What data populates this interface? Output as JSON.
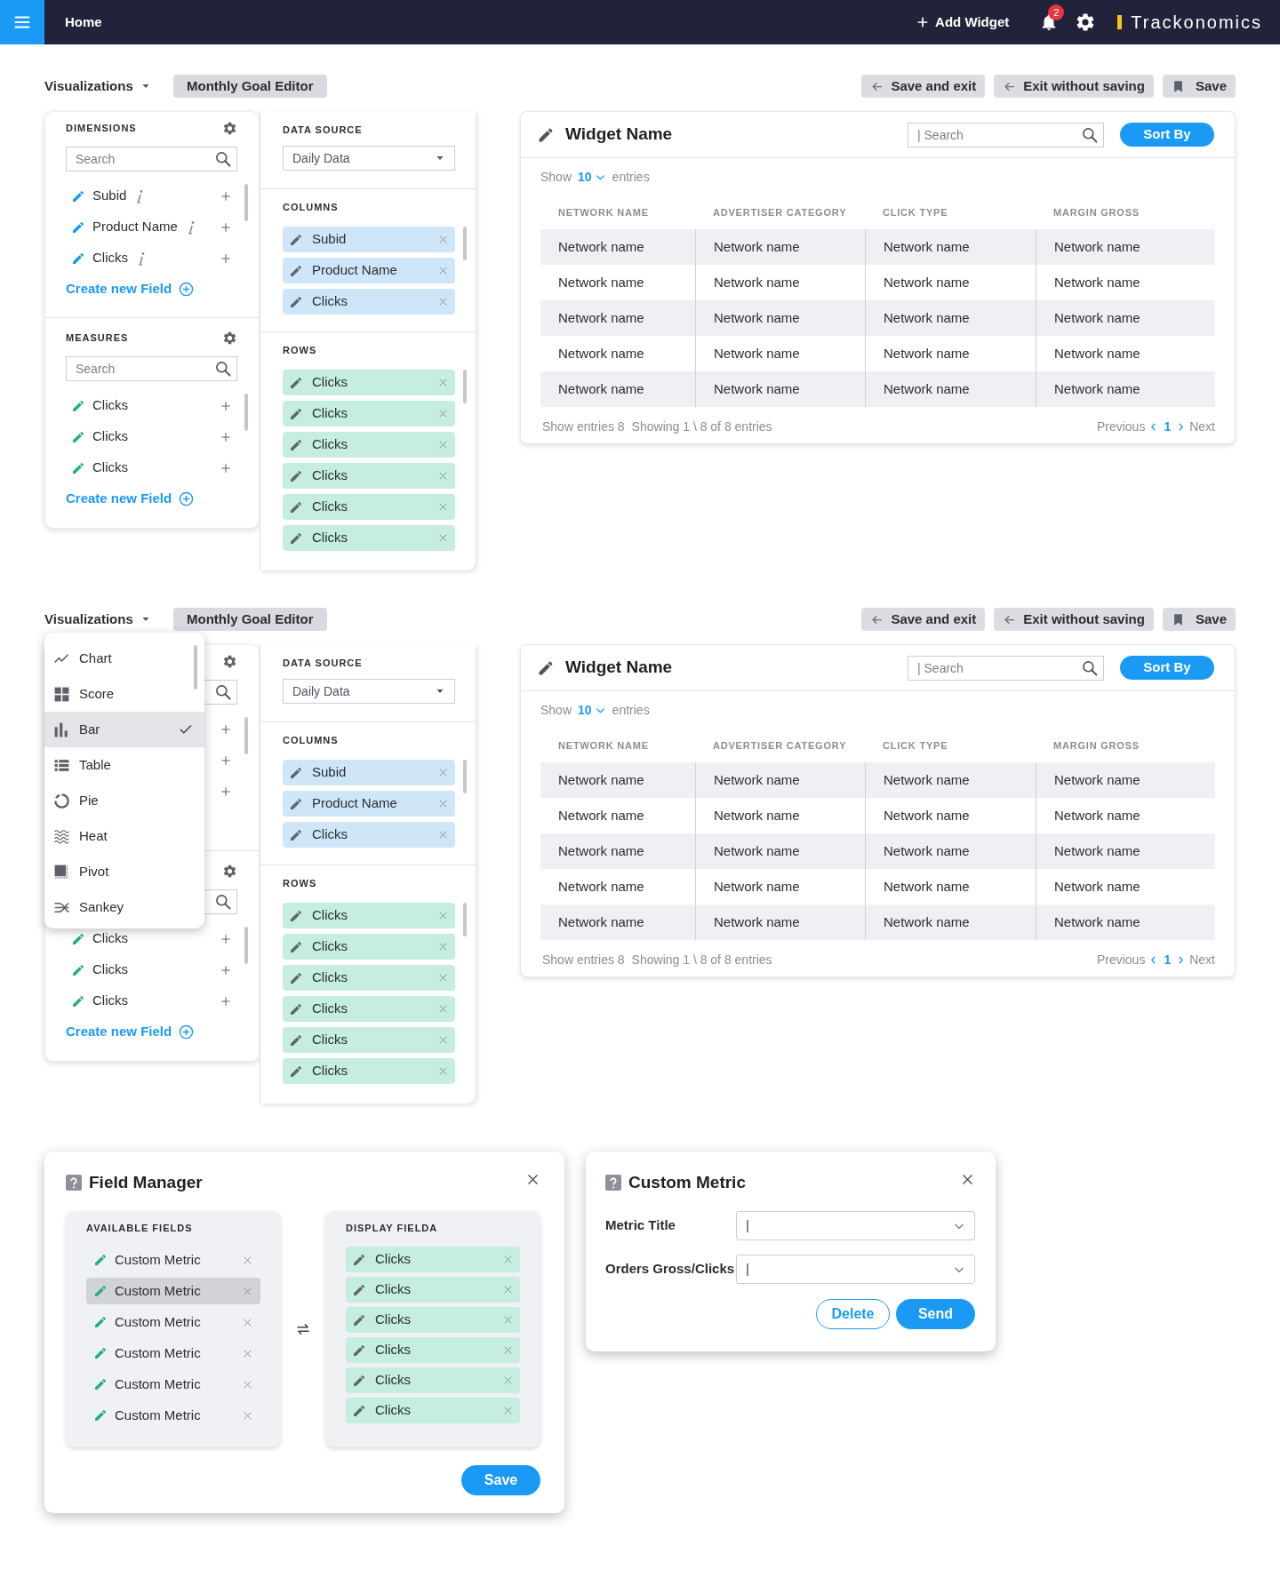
{
  "header": {
    "home": "Home",
    "add_widget": "Add Widget",
    "notification_count": "2",
    "brand": "Trackonomics"
  },
  "editors": [
    {
      "toolbar": {
        "menu": "Visualizations",
        "editor_name": "Monthly Goal Editor",
        "buttons": [
          {
            "label": "Save and exit",
            "kind": "back"
          },
          {
            "label": "Exit without saving",
            "kind": "back"
          },
          {
            "label": "Save",
            "kind": "bookmark"
          }
        ]
      },
      "dimensions": {
        "covered": false,
        "title": "DIMENSIONS",
        "search_placeholder": "Search",
        "items": [
          {
            "label": "Subid",
            "info": true
          },
          {
            "label": "Product Name",
            "info": true
          },
          {
            "label": "Clicks",
            "info": true
          }
        ],
        "create_link": "Create new Field"
      },
      "measures": {
        "title": "MEASURES",
        "search_placeholder": "Search",
        "items": [
          {
            "label": "Clicks",
            "info": false
          },
          {
            "label": "Clicks",
            "info": false
          },
          {
            "label": "Clicks",
            "info": false
          }
        ],
        "create_link": "Create new Field"
      },
      "data_source": {
        "title": "DATA SOURCE",
        "value": "Daily Data"
      },
      "columns": {
        "title": "COLUMNS",
        "chips": [
          "Subid",
          "Product Name",
          "Clicks"
        ]
      },
      "rows": {
        "title": "ROWS",
        "chips": [
          "Clicks",
          "Clicks",
          "Clicks",
          "Clicks",
          "Clicks",
          "Clicks"
        ]
      },
      "widget": {
        "title": "Widget Name",
        "search_placeholder": "| Search",
        "sort_button": "Sort By",
        "show_label": "Show",
        "page_size": "10",
        "entries_label": "entries",
        "columns": [
          "NETWORK NAME",
          "ADVERTISER CATEGORY",
          "CLICK TYPE",
          "MARGIN GROSS"
        ],
        "rows": [
          [
            "Network name",
            "Network name",
            "Network name",
            "Network name"
          ],
          [
            "Network name",
            "Network name",
            "Network name",
            "Network name"
          ],
          [
            "Network name",
            "Network name",
            "Network name",
            "Network name"
          ],
          [
            "Network name",
            "Network name",
            "Network name",
            "Network name"
          ],
          [
            "Network name",
            "Network name",
            "Network name",
            "Network name"
          ]
        ],
        "footer_count": "Show entries 8",
        "footer_range": "Showing 1 \\ 8 of 8 entries",
        "previous": "Previous",
        "page": "1",
        "next": "Next"
      }
    },
    {
      "toolbar": {
        "menu": "Visualizations",
        "editor_name": "Monthly Goal Editor",
        "buttons": [
          {
            "label": "Save and exit",
            "kind": "back"
          },
          {
            "label": "Exit without saving",
            "kind": "back"
          },
          {
            "label": "Save",
            "kind": "bookmark"
          }
        ]
      },
      "visualization_menu": {
        "items": [
          {
            "label": "Chart",
            "kind": "line",
            "selected": false
          },
          {
            "label": "Score",
            "kind": "grid",
            "selected": false
          },
          {
            "label": "Bar",
            "kind": "bar",
            "selected": true
          },
          {
            "label": "Table",
            "kind": "table",
            "selected": false
          },
          {
            "label": "Pie",
            "kind": "pie",
            "selected": false
          },
          {
            "label": "Heat",
            "kind": "heat",
            "selected": false
          },
          {
            "label": "Pivot",
            "kind": "pivot",
            "selected": false
          },
          {
            "label": "Sankey",
            "kind": "sankey",
            "selected": false
          }
        ]
      },
      "dimensions": {
        "covered": true
      },
      "measures": {
        "items": [
          {
            "label": "Clicks",
            "info": false
          },
          {
            "label": "Clicks",
            "info": false
          },
          {
            "label": "Clicks",
            "info": false
          }
        ],
        "create_link": "Create new Field"
      },
      "data_source": {
        "title": "DATA SOURCE",
        "value": "Daily Data"
      },
      "columns": {
        "title": "COLUMNS",
        "chips": [
          "Subid",
          "Product Name",
          "Clicks"
        ]
      },
      "rows": {
        "title": "ROWS",
        "chips": [
          "Clicks",
          "Clicks",
          "Clicks",
          "Clicks",
          "Clicks",
          "Clicks"
        ]
      },
      "widget": {
        "title": "Widget Name",
        "search_placeholder": "| Search",
        "sort_button": "Sort By",
        "show_label": "Show",
        "page_size": "10",
        "entries_label": "entries",
        "columns": [
          "NETWORK NAME",
          "ADVERTISER CATEGORY",
          "CLICK TYPE",
          "MARGIN GROSS"
        ],
        "rows": [
          [
            "Network name",
            "Network name",
            "Network name",
            "Network name"
          ],
          [
            "Network name",
            "Network name",
            "Network name",
            "Network name"
          ],
          [
            "Network name",
            "Network name",
            "Network name",
            "Network name"
          ],
          [
            "Network name",
            "Network name",
            "Network name",
            "Network name"
          ],
          [
            "Network name",
            "Network name",
            "Network name",
            "Network name"
          ]
        ],
        "footer_count": "Show entries 8",
        "footer_range": "Showing 1 \\ 8 of 8 entries",
        "previous": "Previous",
        "page": "1",
        "next": "Next"
      }
    }
  ],
  "field_manager": {
    "title": "Field Manager",
    "available_title": "AVAILABLE FIELDS",
    "available": [
      {
        "label": "Custom Metric",
        "selected": false
      },
      {
        "label": "Custom Metric",
        "selected": true
      },
      {
        "label": "Custom Metric",
        "selected": false
      },
      {
        "label": "Custom Metric",
        "selected": false
      },
      {
        "label": "Custom Metric",
        "selected": false
      },
      {
        "label": "Custom Metric",
        "selected": false
      }
    ],
    "display_title": "DISPLAY FIELDA",
    "display": [
      "Clicks",
      "Clicks",
      "Clicks",
      "Clicks",
      "Clicks",
      "Clicks"
    ],
    "save": "Save"
  },
  "custom_metric": {
    "title": "Custom Metric",
    "fields": [
      {
        "label": "Metric Title",
        "value": "|"
      },
      {
        "label": "Orders Gross/Clicks",
        "value": "|"
      }
    ],
    "delete": "Delete",
    "send": "Send"
  }
}
